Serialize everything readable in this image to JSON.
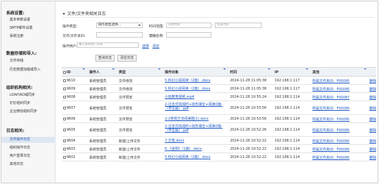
{
  "sidebar": {
    "sections": [
      {
        "title": "系统设置:",
        "items": [
          "基本参数设置",
          "SMTP邮件设置",
          "系统注册"
        ]
      },
      {
        "title": "数据存储和导入:",
        "items": [
          "文件存储",
          "历史数据加载或导入"
        ]
      },
      {
        "title": "组织机构相关:",
        "items": [
          "LDAP/AD域同步",
          "钉钉组织同步",
          "企业微信组织同步"
        ]
      },
      {
        "title": "日志相关:",
        "items": [
          "文件操作日志",
          "组织操作日志",
          "用户登录日志",
          "其他日志"
        ]
      }
    ],
    "active_item": "文件操作日志"
  },
  "page": {
    "title": "文件/文件夹相关日志"
  },
  "filters": {
    "op_type_label": "操作类型:",
    "op_type_value": "操作类型选择...",
    "time_label": "时间范围:",
    "time_start_placeholder": "开始时间",
    "time_end_placeholder": "结束时间",
    "file_id_label": "文件/文件夹ID:",
    "fuzzy_label": "模糊名称:",
    "user_label": "操作用户:",
    "user_placeholder": "输入查询用户名称",
    "select_link": "选择",
    "clear_link": "清空",
    "search_button": "查询日志",
    "clear_button": "清空日志"
  },
  "table": {
    "columns": [
      "ID",
      "操作人",
      "类型",
      "操作对象",
      "时间",
      "IP",
      "其他"
    ],
    "rows": [
      {
        "id": "9610",
        "user": "系统管理员",
        "type": "文件修改",
        "target": "5.科幻小说阅读（2篇）.docx",
        "time": "2024-11-28 11:05:38",
        "ip": "192.168.1.117",
        "other": "所属文件夹ID：F00095"
      },
      {
        "id": "9609",
        "user": "系统管理员",
        "type": "文件修改",
        "target": "5.科幻小说阅读（2篇）.docx",
        "time": "2024-11-28 11:05:38",
        "ip": "192.168.1.117",
        "other": "所属文件夹ID：F00095"
      },
      {
        "id": "9608",
        "user": "系统管理员",
        "type": "文件预览",
        "target": "小班教育视频.mp4",
        "time": "2024-11-28 10:55:24",
        "ip": "192.168.1.114",
        "other": "所属文件夹ID：F00087"
      },
      {
        "id": "9607",
        "user": "系统管理员",
        "type": "文件预览",
        "target": "2-过去式完成时+完形填空+阅读D篇-（学生版）.pdf",
        "time": "2024-11-28 10:53:56",
        "ip": "192.168.1.114",
        "other": "所属文件夹ID：F00095"
      },
      {
        "id": "9606",
        "user": "系统管理员",
        "type": "文件预览",
        "target": "2-2常规方法阅读题(1).docx",
        "time": "2024-11-28 10:53:56",
        "ip": "192.168.1.114",
        "other": "所属文件夹ID：F00095"
      },
      {
        "id": "9605",
        "user": "系统管理员",
        "type": "文件预览",
        "target": "2-过去式完成时+完形填空+阅读D篇-（学生版）.pdf",
        "time": "2024-11-28 10:52:26",
        "ip": "192.168.1.114",
        "other": "所属文件夹ID：F00095"
      },
      {
        "id": "9604",
        "user": "系统管理员",
        "type": "新建/上传文件",
        "target": "7.文笔.docx",
        "time": "2024-11-28 10:52:22",
        "ip": "192.168.1.114",
        "other": "所属文件夹ID：F00095"
      },
      {
        "id": "9603",
        "user": "系统管理员",
        "type": "新建/上传文件",
        "target": "6.《洛阳》（1篇）.docx",
        "time": "2024-11-28 10:52:22",
        "ip": "192.168.1.114",
        "other": "所属文件夹ID：F00095"
      },
      {
        "id": "9602",
        "user": "系统管理员",
        "type": "新建/上传文件",
        "target": "5.科幻小说阅读（2篇）.docx",
        "time": "2024-11-28 10:52:22",
        "ip": "192.168.1.114",
        "other": "所属文件夹ID：F00095"
      }
    ],
    "action_label": "删除"
  },
  "colors": {
    "link": "#1a56c4",
    "sort_marker": "#3a6fc6",
    "active_bg": "#dfe7f3"
  }
}
